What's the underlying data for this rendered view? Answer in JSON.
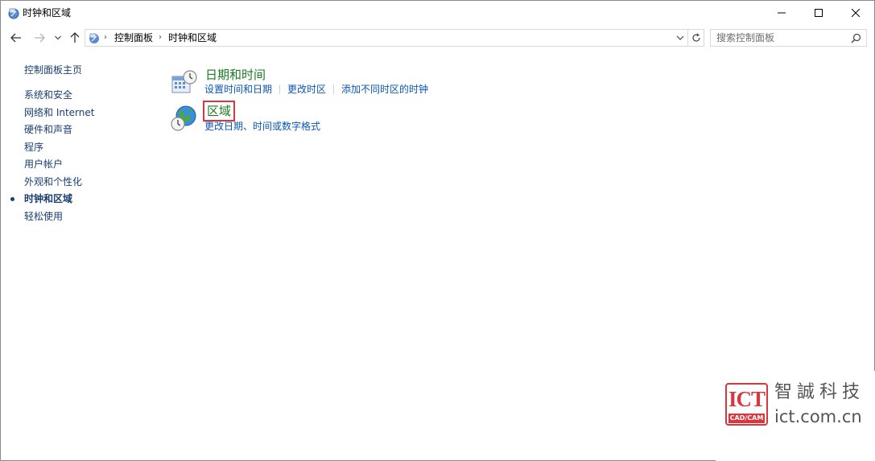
{
  "window": {
    "title": "时钟和区域",
    "app_icon": "control-panel-icon",
    "controls": [
      "minimize-icon",
      "maximize-icon",
      "close-icon"
    ]
  },
  "navigation": {
    "back_icon": "arrow-left-icon",
    "forward_icon": "arrow-right-icon",
    "recent_icon": "chevron-down-icon",
    "up_icon": "arrow-up-icon",
    "breadcrumbs": [
      "控制面板",
      "时钟和区域"
    ],
    "refresh_icon": "refresh-icon",
    "search_placeholder": "搜索控制面板"
  },
  "sidebar": {
    "home": "控制面板主页",
    "items": [
      {
        "label": "系统和安全",
        "current": false
      },
      {
        "label": "网络和 Internet",
        "current": false
      },
      {
        "label": "硬件和声音",
        "current": false
      },
      {
        "label": "程序",
        "current": false
      },
      {
        "label": "用户帐户",
        "current": false
      },
      {
        "label": "外观和个性化",
        "current": false
      },
      {
        "label": "时钟和区域",
        "current": true
      },
      {
        "label": "轻松使用",
        "current": false
      }
    ]
  },
  "categories": [
    {
      "title": "日期和时间",
      "icon": "date-time-icon",
      "links": [
        "设置时间和日期",
        "更改时区",
        "添加不同时区的时钟"
      ],
      "highlighted": false
    },
    {
      "title": "区域",
      "icon": "globe-clock-icon",
      "links": [
        "更改日期、时间或数字格式"
      ],
      "highlighted": true
    }
  ],
  "watermark": {
    "logo_text": "ICT",
    "logo_sub": "CAD/CAM",
    "company": "智誠科技",
    "url": "ict.com.cn"
  },
  "colors": {
    "category_title": "#1a7a22",
    "link": "#0a56b8",
    "sidebar_text": "#1a3e72",
    "highlight_border": "#d9363e"
  }
}
